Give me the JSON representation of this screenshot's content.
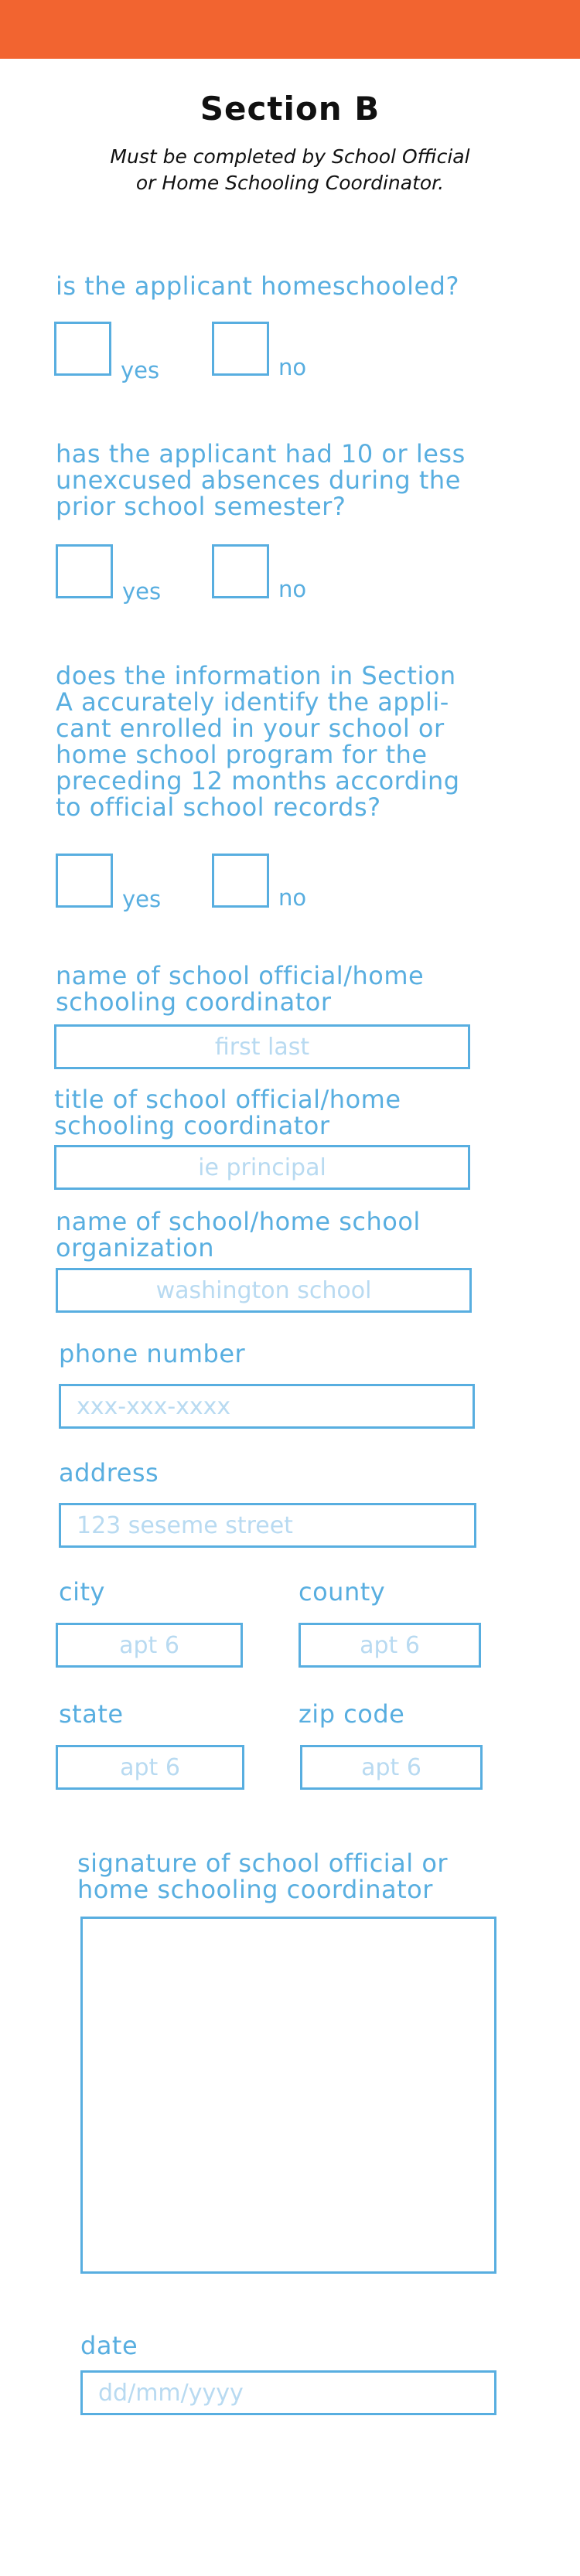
{
  "section": {
    "title": "Section B",
    "subtitle": "Must be completed by School Official\nor Home Schooling Coordinator."
  },
  "questions": [
    {
      "text": "is the applicant homeschooled?",
      "yes": "yes",
      "no": "no"
    },
    {
      "text": "has the applicant had 10 or less\nunexcused absences during the\nprior school semester?",
      "yes": "yes",
      "no": "no"
    },
    {
      "text": "does the information in Section\nA accurately identify the appli-\ncant enrolled in your school or\nhome school program for the\npreceding 12 months according\nto official school records?",
      "yes": "yes",
      "no": "no"
    }
  ],
  "fields": {
    "official_name": {
      "label": "name of school official/home\nschooling coordinator",
      "placeholder": "first last"
    },
    "official_title": {
      "label": "title of school official/home\nschooling coordinator",
      "placeholder": "ie principal"
    },
    "school_name": {
      "label": "name of school/home school\norganization",
      "placeholder": "washington school"
    },
    "phone": {
      "label": "phone number",
      "placeholder": "xxx-xxx-xxxx"
    },
    "address": {
      "label": "address",
      "placeholder": "123 seseme street"
    },
    "city": {
      "label": "city",
      "placeholder": "apt 6"
    },
    "county": {
      "label": "county",
      "placeholder": "apt 6"
    },
    "state": {
      "label": "state",
      "placeholder": "apt 6"
    },
    "zip": {
      "label": "zip code",
      "placeholder": "apt 6"
    },
    "signature": {
      "label": "signature of school official or\nhome schooling coordinator"
    },
    "date": {
      "label": "date",
      "placeholder": "dd/mm/yyyy"
    }
  },
  "colors": {
    "accent": "#58aee0",
    "header_bar": "#f26430",
    "placeholder": "#b8daf1"
  }
}
